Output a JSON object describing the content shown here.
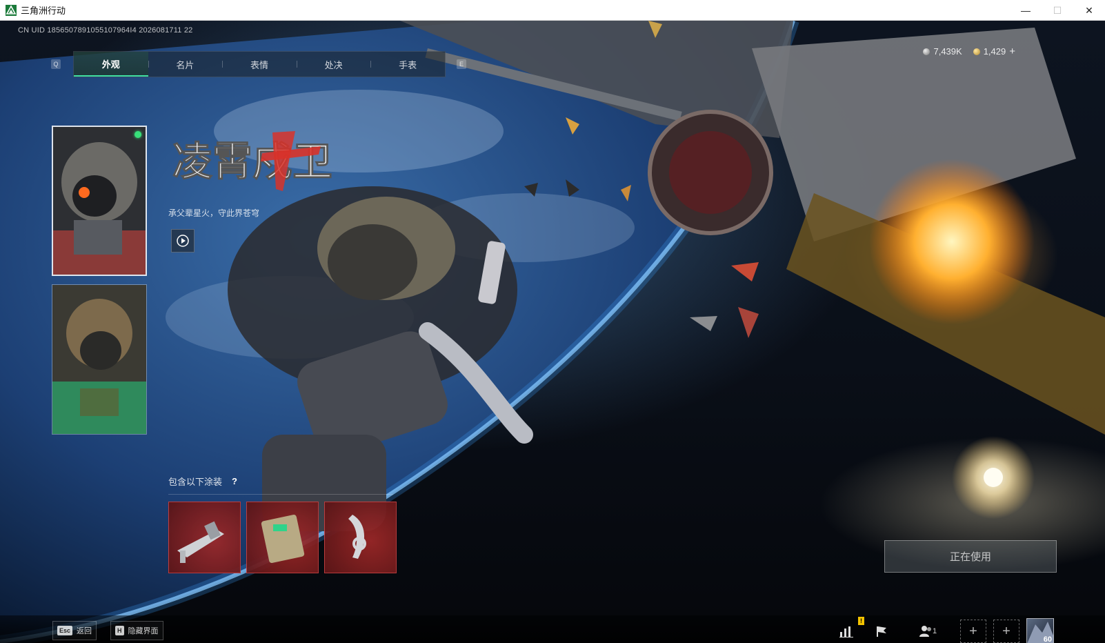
{
  "window": {
    "title": "三角洲行动",
    "minimize": "—",
    "maximize": "☐",
    "close": "✕"
  },
  "uid": "CN UID 1856507891055107964I4 2026081711 22",
  "tabs": {
    "left_key": "Q",
    "right_key": "E",
    "items": [
      "外观",
      "名片",
      "表情",
      "处决",
      "手表"
    ]
  },
  "currency": {
    "silver": "7,439K",
    "gold": "1,429",
    "add": "+"
  },
  "skin": {
    "name": "凌霄戍卫",
    "slogan": "承父辈星火，守此界苍穹"
  },
  "paints": {
    "label": "包含以下涂装",
    "help": "?"
  },
  "in_use_button": "正在使用",
  "bottom": {
    "esc_key": "Esc",
    "esc_label": "返回",
    "hide_key": "H",
    "hide_label": "隐藏界面",
    "warn_badge": "!",
    "party_count": "1",
    "add_slot": "+",
    "avatar_level": "60"
  },
  "colors": {
    "active_tab_accent": "#3fe0a2",
    "online_dot": "#38e07a",
    "title_red": "#d8322a"
  }
}
